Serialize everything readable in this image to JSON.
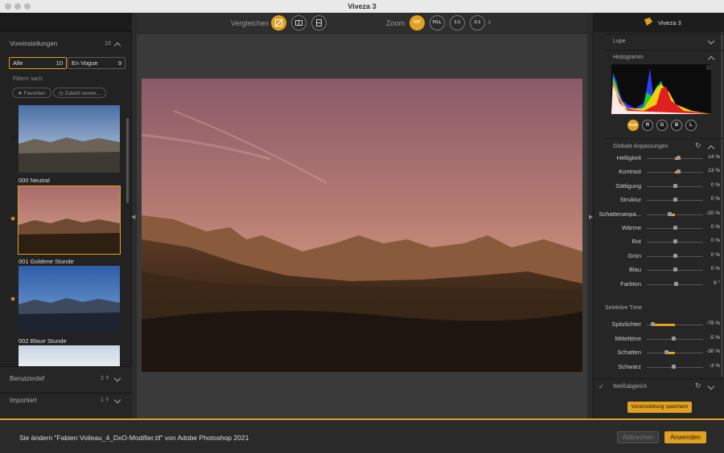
{
  "window": {
    "title": "Viveza 3"
  },
  "left": {
    "presets_header": "Voreinstellungen",
    "presets_count": "10",
    "seg_all": {
      "label": "Alle",
      "count": "10"
    },
    "seg_vogue": {
      "label": "En Vogue",
      "count": "9"
    },
    "filter_label": "Filtern nach:",
    "filter_favorites": "Favoriten",
    "filter_recent": "Zuletzt verwe...",
    "presets": [
      {
        "label": "000 Neutral",
        "starred": false
      },
      {
        "label": "001 Goldene Stunde",
        "starred": true,
        "selected": true
      },
      {
        "label": "002 Blaue Stunde",
        "starred": true
      }
    ],
    "user_defined": {
      "label": "Benutzerdef",
      "count": "2"
    },
    "imported": {
      "label": "Importiert",
      "count": "1"
    }
  },
  "toolbar": {
    "compare_label": "Vergleichen",
    "zoom_label": "Zoom",
    "zoom_fit": "FIT",
    "zoom_fill": "FILL",
    "zoom_1_1": "1:1",
    "zoom_2_1": "2:1"
  },
  "right": {
    "app_name": "Viveza 3",
    "loupe": "Lupe",
    "histogram": "Histogramm",
    "channels": [
      "RGB",
      "R",
      "G",
      "B",
      "L"
    ],
    "global_header": "Globale Anpassungen",
    "global": [
      {
        "label": "Helligkeit",
        "value": "14 %",
        "amount": 14
      },
      {
        "label": "Kontrast",
        "value": "13 %",
        "amount": 13
      },
      {
        "label": "Sättigung",
        "value": "0 %",
        "amount": 0
      },
      {
        "label": "Struktur",
        "value": "0 %",
        "amount": 0
      },
      {
        "label": "Schattenanpa...",
        "value": "-20 %",
        "amount": -20
      },
      {
        "label": "Wärme",
        "value": "0 %",
        "amount": 0
      },
      {
        "label": "Rot",
        "value": "0 %",
        "amount": 0
      },
      {
        "label": "Grün",
        "value": "0 %",
        "amount": 0
      },
      {
        "label": "Blau",
        "value": "0 %",
        "amount": 0
      },
      {
        "label": "Farbton",
        "value": "9 °",
        "amount": 5
      }
    ],
    "selective_header": "Selektive Töne",
    "selective": [
      {
        "label": "Spitzlichter",
        "value": "-78 %",
        "amount": -78
      },
      {
        "label": "Mitteltöne",
        "value": "-5 %",
        "amount": -5
      },
      {
        "label": "Schatten",
        "value": "-30 %",
        "amount": -30
      },
      {
        "label": "Schwarz",
        "value": "-3 %",
        "amount": -3
      }
    ],
    "white_balance": "Weißabgleich",
    "save_preset": "Voreinstellung speichern"
  },
  "bottom": {
    "message": "Sie ändern \"Fabien Voileau_4_DxO-Modifier.tif\" von Adobe Photoshop 2021",
    "cancel": "Abbrechen",
    "apply": "Anwenden"
  },
  "colors": {
    "accent": "#e0a020"
  }
}
